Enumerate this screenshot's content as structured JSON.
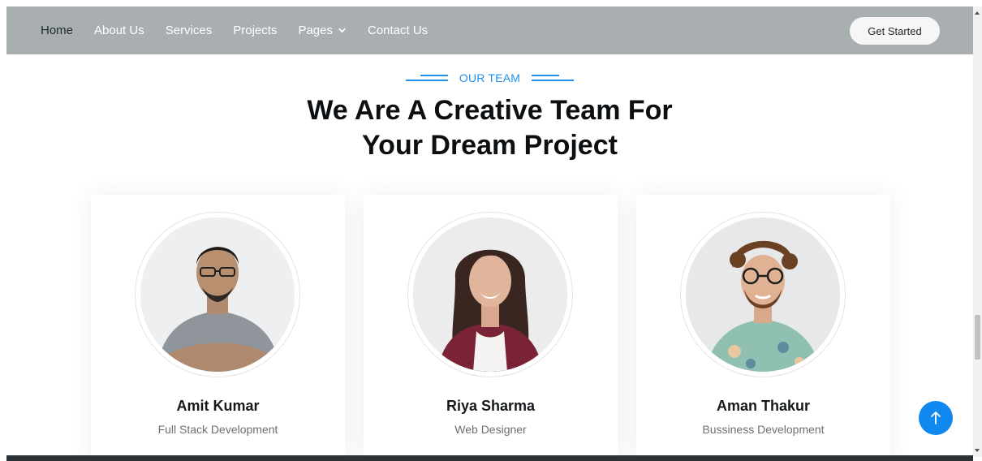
{
  "nav": {
    "items": [
      {
        "label": "Home",
        "active": true
      },
      {
        "label": "About Us"
      },
      {
        "label": "Services"
      },
      {
        "label": "Projects"
      },
      {
        "label": "Pages",
        "icon": "chevron-down-icon"
      },
      {
        "label": "Contact Us"
      }
    ],
    "cta_label": "Get Started"
  },
  "section": {
    "eyebrow": "OUR TEAM",
    "title_line1": "We Are A Creative Team For",
    "title_line2": "Your Dream Project"
  },
  "team": [
    {
      "name": "Amit Kumar",
      "role": "Full Stack Development"
    },
    {
      "name": "Riya Sharma",
      "role": "Web Designer"
    },
    {
      "name": "Aman Thakur",
      "role": "Bussiness Development"
    }
  ],
  "back_to_top_icon": "arrow-up-icon",
  "colors": {
    "navbar_bg": "#a9aeb0",
    "accent": "#1e90ec",
    "back_to_top": "#1188f0"
  }
}
